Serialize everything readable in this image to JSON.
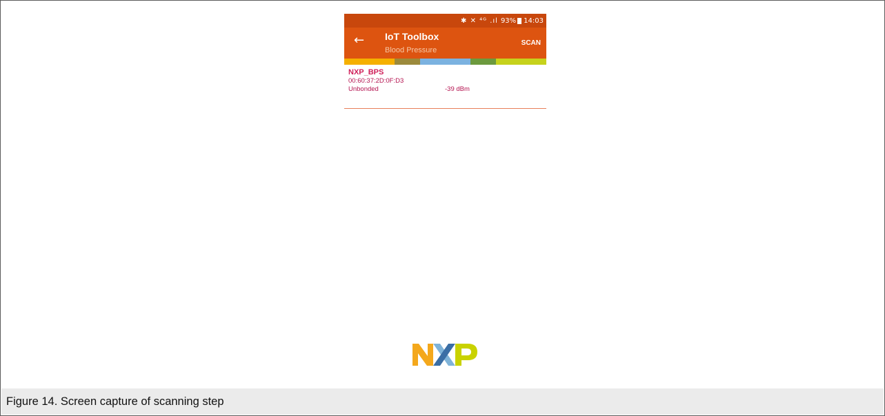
{
  "status_bar": {
    "icons": "✱ ✕ ⁴ᴳ .ıl",
    "battery": "93%",
    "time": "14:03"
  },
  "toolbar": {
    "back_icon": "←",
    "title": "IoT Toolbox",
    "subtitle": "Blood Pressure",
    "scan_label": "SCAN"
  },
  "stripe_colors": [
    "#f5b000",
    "#f5b000",
    "#9c8a3c",
    "#7bb2e0",
    "#7bb2e0",
    "#6c9a3e",
    "#c6d21c",
    "#c6d21c"
  ],
  "devices": [
    {
      "name": "NXP_BPS",
      "mac": "00:60:37:2D:0F:D3",
      "bond_state": "Unbonded",
      "rssi": "-39 dBm"
    }
  ],
  "logo": {
    "text": "NXP",
    "colors": {
      "n": "#f4a81c",
      "x1": "#7fb3d8",
      "x2": "#3a6ea5",
      "p": "#c9d200"
    }
  },
  "caption": "Figure 14. Screen capture of scanning step"
}
